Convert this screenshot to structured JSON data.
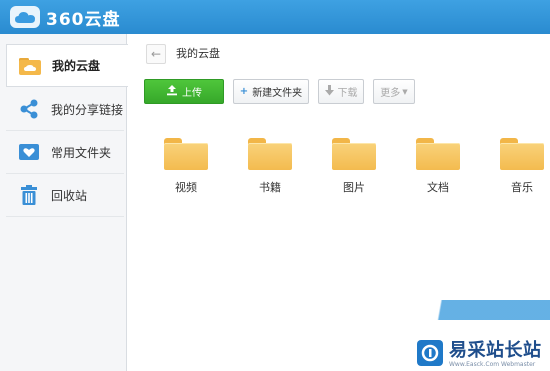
{
  "app": {
    "title": "360云盘"
  },
  "sidebar": {
    "items": [
      {
        "label": "我的云盘",
        "icon": "folder-cloud-icon",
        "active": true
      },
      {
        "label": "我的分享链接",
        "icon": "share-icon",
        "active": false
      },
      {
        "label": "常用文件夹",
        "icon": "heart-folder-icon",
        "active": false
      },
      {
        "label": "回收站",
        "icon": "trash-icon",
        "active": false
      }
    ]
  },
  "breadcrumb": {
    "current": "我的云盘"
  },
  "toolbar": {
    "upload_label": "上传",
    "new_folder_label": "新建文件夹",
    "download_label": "下载",
    "more_label": "更多"
  },
  "folders": [
    {
      "label": "视频"
    },
    {
      "label": "书籍"
    },
    {
      "label": "图片"
    },
    {
      "label": "文档"
    },
    {
      "label": "音乐"
    }
  ],
  "watermark": {
    "name": "易采站长站",
    "sub": "Www.Easck.Com Webmaster"
  },
  "colors": {
    "topbar": "#3a9be0",
    "upload": "#3fb531",
    "folder": "#f6c35d"
  }
}
